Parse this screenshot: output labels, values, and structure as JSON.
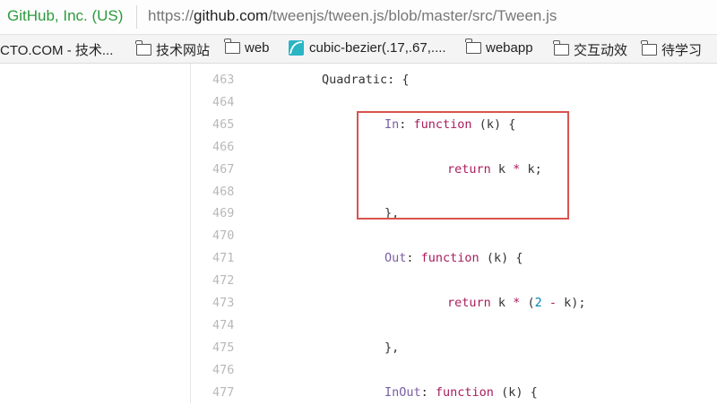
{
  "address_bar": {
    "site_identity": "GitHub, Inc. (US)",
    "url_scheme": "https://",
    "url_host": "github.com",
    "url_path": "/tweenjs/tween.js/blob/master/src/Tween.js"
  },
  "bookmarks": [
    {
      "label": "CTO.COM - 技术...",
      "icon": "none"
    },
    {
      "label": "技术网站",
      "icon": "folder-icon"
    },
    {
      "label": "web",
      "icon": "folder-icon"
    },
    {
      "label": "cubic-bezier(.17,.67,....",
      "icon": "bezier-icon"
    },
    {
      "label": "webapp",
      "icon": "folder-icon"
    },
    {
      "label": "交互动效",
      "icon": "folder-icon"
    },
    {
      "label": "待学习",
      "icon": "folder-icon"
    }
  ],
  "code_lines": [
    {
      "num": "463",
      "tokens": [
        {
          "t": "Quadratic",
          "c": "txt"
        },
        {
          "t": ": {",
          "c": "txt"
        }
      ]
    },
    {
      "num": "464",
      "tokens": []
    },
    {
      "num": "465",
      "tokens": [
        {
          "t": "In",
          "c": "key"
        },
        {
          "t": ": ",
          "c": "txt"
        },
        {
          "t": "function",
          "c": "kw"
        },
        {
          "t": " (k) {",
          "c": "txt"
        }
      ]
    },
    {
      "num": "466",
      "tokens": []
    },
    {
      "num": "467",
      "tokens": [
        {
          "t": "return",
          "c": "kw"
        },
        {
          "t": " k ",
          "c": "txt"
        },
        {
          "t": "*",
          "c": "kw"
        },
        {
          "t": " k;",
          "c": "txt"
        }
      ]
    },
    {
      "num": "468",
      "tokens": []
    },
    {
      "num": "469",
      "tokens": [
        {
          "t": "},",
          "c": "txt"
        }
      ]
    },
    {
      "num": "470",
      "tokens": []
    },
    {
      "num": "471",
      "tokens": [
        {
          "t": "Out",
          "c": "key"
        },
        {
          "t": ": ",
          "c": "txt"
        },
        {
          "t": "function",
          "c": "kw"
        },
        {
          "t": " (k) {",
          "c": "txt"
        }
      ]
    },
    {
      "num": "472",
      "tokens": []
    },
    {
      "num": "473",
      "tokens": [
        {
          "t": "return",
          "c": "kw"
        },
        {
          "t": " k ",
          "c": "txt"
        },
        {
          "t": "*",
          "c": "kw"
        },
        {
          "t": " (",
          "c": "txt"
        },
        {
          "t": "2",
          "c": "num"
        },
        {
          "t": " ",
          "c": "txt"
        },
        {
          "t": "-",
          "c": "kw"
        },
        {
          "t": " k);",
          "c": "txt"
        }
      ]
    },
    {
      "num": "474",
      "tokens": []
    },
    {
      "num": "475",
      "tokens": [
        {
          "t": "},",
          "c": "txt"
        }
      ]
    },
    {
      "num": "476",
      "tokens": []
    },
    {
      "num": "477",
      "tokens": [
        {
          "t": "InOut",
          "c": "key"
        },
        {
          "t": ": ",
          "c": "txt"
        },
        {
          "t": "function",
          "c": "kw"
        },
        {
          "t": " (k) {",
          "c": "txt"
        }
      ]
    }
  ],
  "colors": {
    "site_identity": "#2c9b3c",
    "keyword": "#a71d5d",
    "property": "#795da3",
    "number": "#0086b3",
    "highlight_box": "#d9534f"
  }
}
